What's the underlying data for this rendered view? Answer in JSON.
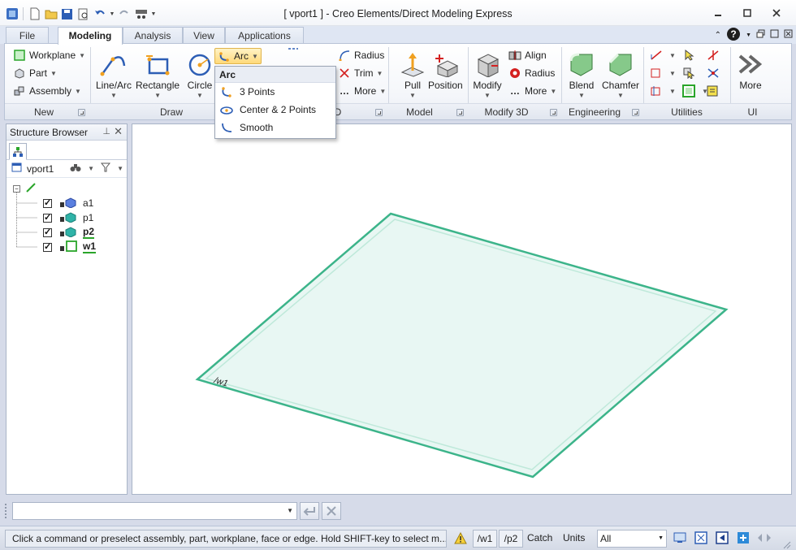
{
  "window": {
    "title": "[ vport1 ] - Creo Elements/Direct Modeling Express"
  },
  "tabs": {
    "file": "File",
    "modeling": "Modeling",
    "analysis": "Analysis",
    "view": "View",
    "applications": "Applications"
  },
  "ribbon": {
    "new": {
      "workplane": "Workplane",
      "part": "Part",
      "assembly": "Assembly",
      "label": "New"
    },
    "draw": {
      "line_arc": "Line/Arc",
      "rectangle": "Rectangle",
      "circle": "Circle",
      "arc": "Arc",
      "label": "Draw"
    },
    "edit2d": {
      "radius": "Radius",
      "trim": "Trim",
      "more": "More",
      "label": "D"
    },
    "model": {
      "pull": "Pull",
      "position": "Position",
      "label": "Model"
    },
    "modify3d": {
      "modify": "Modify",
      "align": "Align",
      "radius": "Radius",
      "more": "More",
      "label": "Modify 3D"
    },
    "engineering": {
      "blend": "Blend",
      "chamfer": "Chamfer",
      "label": "Engineering"
    },
    "utilities": {
      "label": "Utilities"
    },
    "ui": {
      "more": "More",
      "label": "UI"
    }
  },
  "arc_menu": {
    "title": "Arc",
    "items": [
      "3 Points",
      "Center & 2 Points",
      "Smooth"
    ]
  },
  "browser": {
    "title": "Structure Browser",
    "viewport": "vport1",
    "items": [
      {
        "name": "a1",
        "color": "#5a7fe0"
      },
      {
        "name": "p1",
        "color": "#2fb3a8"
      },
      {
        "name": "p2",
        "color": "#2fb3a8"
      },
      {
        "name": "w1",
        "color": "#2aa52a"
      }
    ]
  },
  "viewport": {
    "workplane_label": "/w1"
  },
  "status": {
    "message": "Click a command or preselect assembly, part, workplane, face or edge. Hold SHIFT-key to select m...",
    "workplane": "/w1",
    "part": "/p2",
    "catch": "Catch",
    "units": "Units",
    "filter": "All"
  }
}
